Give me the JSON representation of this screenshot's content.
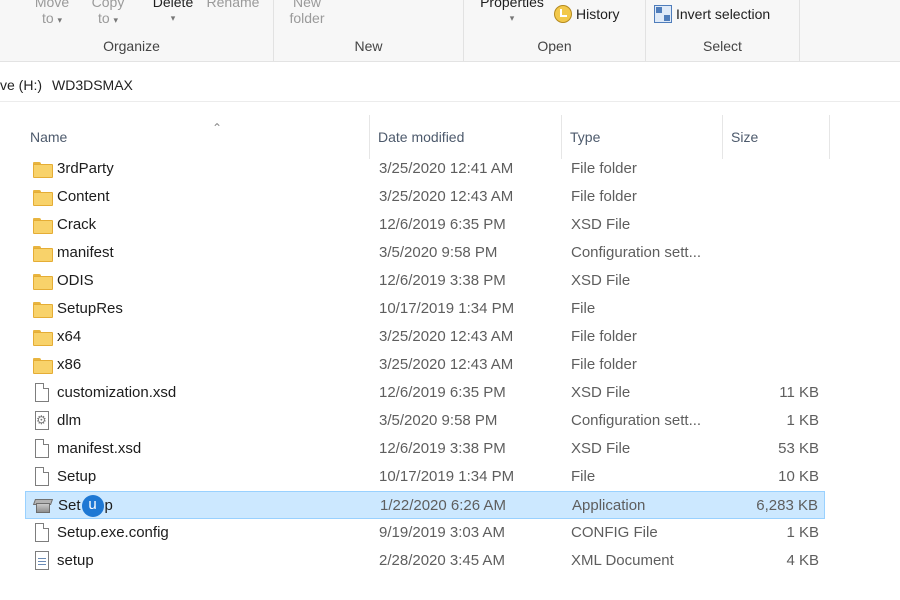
{
  "ribbon": {
    "organize": {
      "label": "Organize",
      "move_to": {
        "line1": "Move",
        "line2": "to"
      },
      "copy_to": {
        "line1": "Copy",
        "line2": "to"
      },
      "delete": "Delete",
      "rename": "Rename"
    },
    "new": {
      "label": "New",
      "new_folder": {
        "line1": "New",
        "line2": "folder"
      }
    },
    "open": {
      "label": "Open",
      "properties": "Properties",
      "history": "History"
    },
    "select": {
      "label": "Select",
      "invert_selection": "Invert selection"
    }
  },
  "address": {
    "drive": "ve (H:)",
    "folder": "WD3DSMAX"
  },
  "columns": {
    "name": "Name",
    "date_modified": "Date modified",
    "type": "Type",
    "size": "Size"
  },
  "files": [
    {
      "icon": "folder-icon",
      "name": "3rdParty",
      "date": "3/25/2020 12:41 AM",
      "type": "File folder",
      "size": ""
    },
    {
      "icon": "folder-icon",
      "name": "Content",
      "date": "3/25/2020 12:43 AM",
      "type": "File folder",
      "size": ""
    },
    {
      "icon": "folder-icon",
      "name": "Crack",
      "date": "12/6/2019 6:35 PM",
      "type": "XSD File",
      "size": ""
    },
    {
      "icon": "folder-icon",
      "name": "manifest",
      "date": "3/5/2020 9:58 PM",
      "type": "Configuration sett...",
      "size": ""
    },
    {
      "icon": "folder-icon",
      "name": "ODIS",
      "date": "12/6/2019 3:38 PM",
      "type": "XSD File",
      "size": ""
    },
    {
      "icon": "folder-icon",
      "name": "SetupRes",
      "date": "10/17/2019 1:34 PM",
      "type": "File",
      "size": ""
    },
    {
      "icon": "folder-icon",
      "name": "x64",
      "date": "3/25/2020 12:43 AM",
      "type": "File folder",
      "size": ""
    },
    {
      "icon": "folder-icon",
      "name": "x86",
      "date": "3/25/2020 12:43 AM",
      "type": "File folder",
      "size": ""
    },
    {
      "icon": "file-icon",
      "name": "customization.xsd",
      "date": "12/6/2019 6:35 PM",
      "type": "XSD File",
      "size": "11 KB"
    },
    {
      "icon": "settings-file-icon",
      "name": "dlm",
      "date": "3/5/2020 9:58 PM",
      "type": "Configuration sett...",
      "size": "1 KB"
    },
    {
      "icon": "file-icon",
      "name": "manifest.xsd",
      "date": "12/6/2019 3:38 PM",
      "type": "XSD File",
      "size": "53 KB"
    },
    {
      "icon": "file-icon",
      "name": "Setup",
      "date": "10/17/2019 1:34 PM",
      "type": "File",
      "size": "10 KB"
    },
    {
      "icon": "application-icon",
      "name_prefix": "Set",
      "name_cursor": "u",
      "name_suffix": "p",
      "date": "1/22/2020 6:26 AM",
      "type": "Application",
      "size": "6,283 KB",
      "selected": true
    },
    {
      "icon": "file-icon",
      "name": "Setup.exe.config",
      "date": "9/19/2019 3:03 AM",
      "type": "CONFIG File",
      "size": "1 KB"
    },
    {
      "icon": "xml-document-icon",
      "name": "setup",
      "date": "2/28/2020 3:45 AM",
      "type": "XML Document",
      "size": "4 KB"
    }
  ],
  "colors": {
    "selection_bg": "#cce8ff",
    "selection_border": "#99d1ff",
    "folder": "#f8d26a",
    "cursor": "#1e78d4"
  }
}
